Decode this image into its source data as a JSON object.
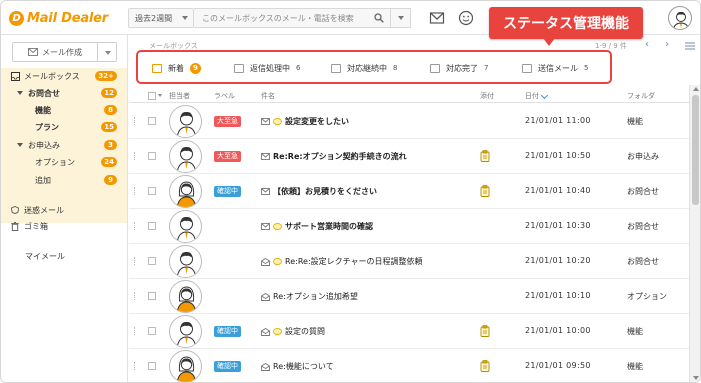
{
  "app": {
    "logo_mark": "D",
    "logo_text": "Mail Dealer",
    "brand_color": "#f39800",
    "callout_color": "#e9433e"
  },
  "header": {
    "period": "過去2週間",
    "search_placeholder": "このメールボックスのメール・電話を検索",
    "callout": "ステータス管理機能"
  },
  "sidebar": {
    "compose_label": "メール作成",
    "mailbox": {
      "label": "メールボックス",
      "count": "32+"
    },
    "groups": [
      {
        "label": "お問合せ",
        "count": "12",
        "children": [
          {
            "label": "機能",
            "count": "8"
          },
          {
            "label": "プラン",
            "count": "15"
          }
        ]
      },
      {
        "label": "お申込み",
        "count": "3",
        "children": [
          {
            "label": "オプション",
            "count": "24"
          },
          {
            "label": "追加",
            "count": "9"
          }
        ]
      }
    ],
    "spam": "迷惑メール",
    "trash": "ゴミ箱",
    "mymail": "マイメール"
  },
  "content": {
    "breadcrumb": "メールボックス",
    "pager": "1-9 / 9 件",
    "tabs": [
      {
        "label": "新着",
        "count": "9",
        "active": true
      },
      {
        "label": "返信処理中",
        "count": "6"
      },
      {
        "label": "対応継続中",
        "count": "8"
      },
      {
        "label": "対応完了",
        "count": "7"
      },
      {
        "label": "送信メール",
        "count": "5"
      }
    ],
    "columns": {
      "assignee": "担当者",
      "label": "ラベル",
      "subject": "件名",
      "attach": "添付",
      "date": "日付",
      "folder": "フォルダ"
    },
    "rows": [
      {
        "label": "大至急",
        "label_color": "#ee5a5a",
        "subject": "設定変更をしたい",
        "bold": true,
        "icon": "mail-bubble",
        "attach": false,
        "date": "21/01/01  11:00",
        "folder": "機能",
        "avatar": "man"
      },
      {
        "label": "大至急",
        "label_color": "#ee5a5a",
        "subject": "Re:Re:オプション契約手続きの流れ",
        "bold": true,
        "icon": "mail",
        "attach": true,
        "date": "21/01/01  10:50",
        "folder": "お申込み",
        "avatar": "man"
      },
      {
        "label": "確認中",
        "label_color": "#3aa0d8",
        "subject": "【依頼】お見積りをください",
        "bold": true,
        "icon": "mail",
        "attach": true,
        "date": "21/01/01  10:40",
        "folder": "お問合せ",
        "avatar": "woman"
      },
      {
        "label": "",
        "label_color": "",
        "subject": "サポート営業時間の確認",
        "bold": true,
        "icon": "mail-bubble",
        "attach": false,
        "date": "21/01/01  10:30",
        "folder": "お問合せ",
        "avatar": "man"
      },
      {
        "label": "",
        "label_color": "",
        "subject": "Re:Re:設定レクチャーの日程調整依頼",
        "bold": false,
        "icon": "open-bubble",
        "attach": false,
        "date": "21/01/01  10:20",
        "folder": "お問合せ",
        "avatar": "man"
      },
      {
        "label": "",
        "label_color": "",
        "subject": "Re:オプション追加希望",
        "bold": false,
        "icon": "open",
        "attach": false,
        "date": "21/01/01  10:10",
        "folder": "オプション",
        "avatar": "woman"
      },
      {
        "label": "確認中",
        "label_color": "#3aa0d8",
        "subject": "設定の質問",
        "bold": false,
        "icon": "open-bubble",
        "attach": true,
        "date": "21/01/01  10:00",
        "folder": "機能",
        "avatar": "man"
      },
      {
        "label": "確認中",
        "label_color": "#3aa0d8",
        "subject": "Re:機能について",
        "bold": false,
        "icon": "open",
        "attach": true,
        "date": "21/01/01  09:50",
        "folder": "機能",
        "avatar": "woman"
      }
    ]
  }
}
